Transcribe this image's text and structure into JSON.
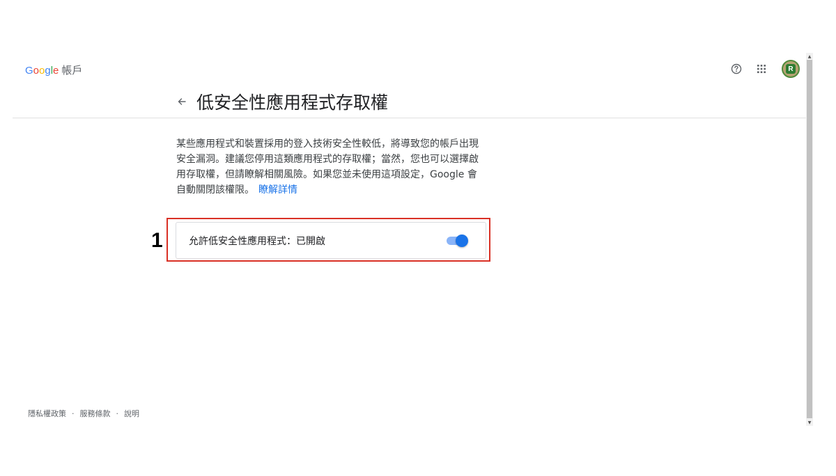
{
  "header": {
    "logo": {
      "letters": [
        {
          "char": "G",
          "color": "#4285F4"
        },
        {
          "char": "o",
          "color": "#EA4335"
        },
        {
          "char": "o",
          "color": "#FBBC05"
        },
        {
          "char": "g",
          "color": "#4285F4"
        },
        {
          "char": "l",
          "color": "#34A853"
        },
        {
          "char": "e",
          "color": "#EA4335"
        }
      ],
      "product": "帳戶"
    },
    "icons": [
      "help-icon",
      "apps-grid-icon",
      "account-avatar"
    ],
    "avatar_letter": "R"
  },
  "page": {
    "title": "低安全性應用程式存取權",
    "description": "某些應用程式和裝置採用的登入技術安全性較低，將導致您的帳戶出現安全漏洞。建議您停用這類應用程式的存取權；當然，您也可以選擇啟用存取權，但請瞭解相關風險。如果您並未使用這項設定，Google 會自動關閉該權限。",
    "learn_more": "瞭解詳情"
  },
  "setting": {
    "label": "允許低安全性應用程式：已開啟",
    "toggle_on": true
  },
  "annotation": {
    "number": "1",
    "color": "#d93025"
  },
  "footer": {
    "privacy": "隱私權政策",
    "terms": "服務條款",
    "help": "說明",
    "separator": "·"
  },
  "colors": {
    "link": "#1a73e8",
    "toggle_track": "#8ab4f8",
    "toggle_knob": "#1a73e8"
  }
}
